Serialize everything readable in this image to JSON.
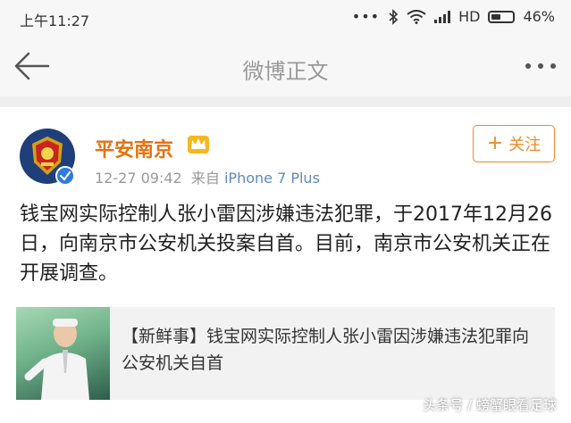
{
  "status_bar": {
    "time": "上午11:27",
    "network_label": "HD",
    "battery": "46%",
    "battery_level": 0.46
  },
  "nav": {
    "title": "微博正文",
    "back_icon": "back-arrow-icon",
    "more_icon": "more-dots-icon"
  },
  "post": {
    "username": "平安南京",
    "timestamp": "12-27 09:42",
    "source_prefix": "来自",
    "source": "iPhone 7 Plus",
    "follow_label": "关注",
    "follow_icon": "plus-icon",
    "text": "钱宝网实际控制人张小雷因涉嫌违法犯罪，于2017年12月26日，向南京市公安机关投案自首。目前，南京市公安机关正在开展调查。",
    "link_card": {
      "title": "【新鲜事】钱宝网实际控制人张小雷因涉嫌违法犯罪向公安机关自首"
    }
  },
  "watermark": "头条号 / 螃蟹眼看足球",
  "colors": {
    "accent": "#e8700a",
    "follow": "#f08a24",
    "link": "#5b8bbd",
    "verified": "#2b7be0"
  }
}
